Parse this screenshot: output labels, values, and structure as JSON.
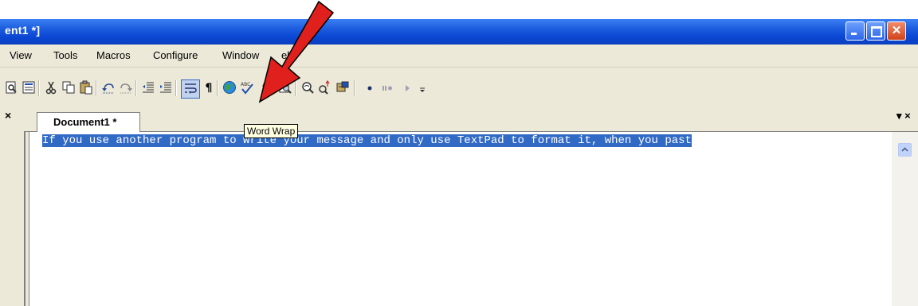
{
  "window": {
    "title": "ent1 *]",
    "controls": {
      "minimize": "minimize",
      "maximize": "maximize",
      "close": "✕"
    }
  },
  "menu": [
    "View",
    "Tools",
    "Macros",
    "Configure",
    "Window",
    "elp"
  ],
  "toolbar": {
    "icons": [
      "print-preview-icon",
      "document-properties-icon",
      "cut-icon",
      "copy-icon",
      "paste-icon",
      "undo-icon",
      "redo-icon",
      "decrease-indent-icon",
      "increase-indent-icon",
      "word-wrap-icon",
      "paragraph-mark-icon",
      "web-globe-icon",
      "spell-check-icon",
      "sort-icon",
      "find-in-files-icon",
      "spy-icon",
      "find-replace-icon",
      "find-icon",
      "record-macro-icon",
      "pause-macro-icon",
      "play-macro-icon"
    ],
    "paragraph_glyph": "¶",
    "spell_glyph": "ᴬᴮᶜ"
  },
  "tooltip": "Word Wrap",
  "document": {
    "tab_label": "Document1 *",
    "panel_close": "×",
    "tab_controls": "▾ ×",
    "line1": "If you use another program to write your message and only use TextPad to format it, when you past"
  },
  "colors": {
    "titlebar": "#0a47d3",
    "selection": "#316ac5",
    "arrow": "#e0201c",
    "tooltip_bg": "#ffffe1",
    "chrome": "#ece9d8"
  }
}
